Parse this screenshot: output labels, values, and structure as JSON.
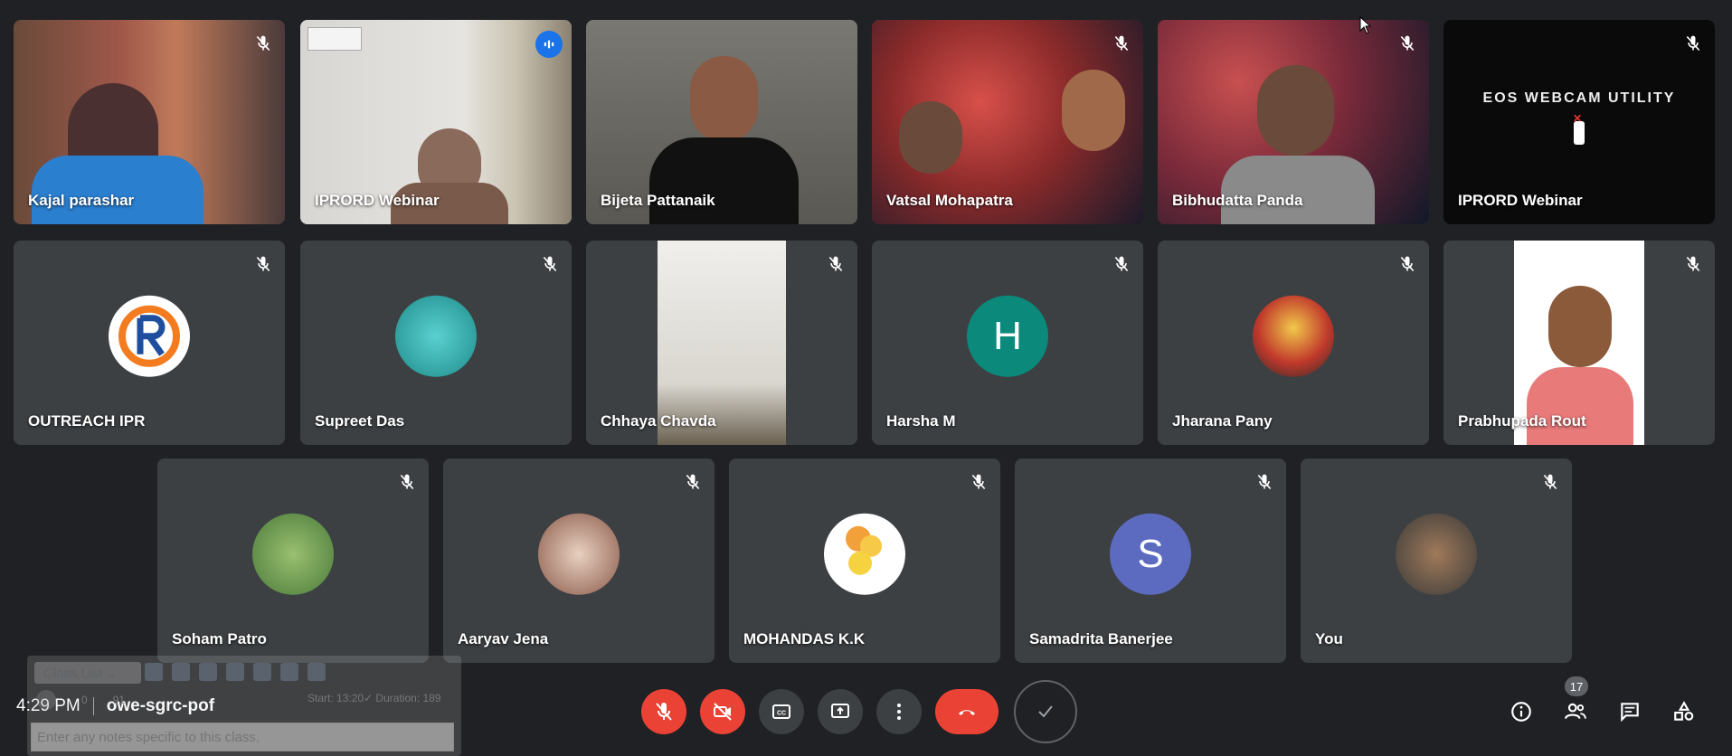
{
  "participants": [
    {
      "name": "Kajal parashar",
      "muted": true
    },
    {
      "name": "IPRORD Webinar",
      "muted": false,
      "speaking": true
    },
    {
      "name": "Bijeta Pattanaik",
      "muted": false
    },
    {
      "name": "Vatsal Mohapatra",
      "muted": true
    },
    {
      "name": "Bibhudatta Panda",
      "muted": true
    },
    {
      "name": "IPRORD Webinar",
      "muted": true,
      "screen_text": "EOS WEBCAM UTILITY"
    },
    {
      "name": "OUTREACH IPR",
      "muted": true
    },
    {
      "name": "Supreet Das",
      "muted": true
    },
    {
      "name": "Chhaya Chavda",
      "muted": true
    },
    {
      "name": "Harsha M",
      "muted": true,
      "initial": "H",
      "color": "#0b8a7c"
    },
    {
      "name": "Jharana Pany",
      "muted": true
    },
    {
      "name": "Prabhupada Rout",
      "muted": true
    },
    {
      "name": "Soham Patro",
      "muted": true
    },
    {
      "name": "Aaryav Jena",
      "muted": true
    },
    {
      "name": "MOHANDAS K.K",
      "muted": true
    },
    {
      "name": "Samadrita Banerjee",
      "muted": true,
      "initial": "S",
      "color": "#5c6bc0"
    },
    {
      "name": "You",
      "muted": true
    }
  ],
  "bottom": {
    "time": "4:29 PM",
    "meeting_code": "owe-sgrc-pof",
    "people_count": "17"
  },
  "overlay": {
    "select_label": "Class List",
    "meta_text": "Start: 13:20✓ Duration: 189",
    "count_a": "0",
    "count_b": "91",
    "notes_placeholder": "Enter any notes specific to this class."
  },
  "colors": {
    "background": "#202124",
    "tile": "#3c4043",
    "danger": "#ea4335",
    "accent": "#8ab4f8"
  }
}
